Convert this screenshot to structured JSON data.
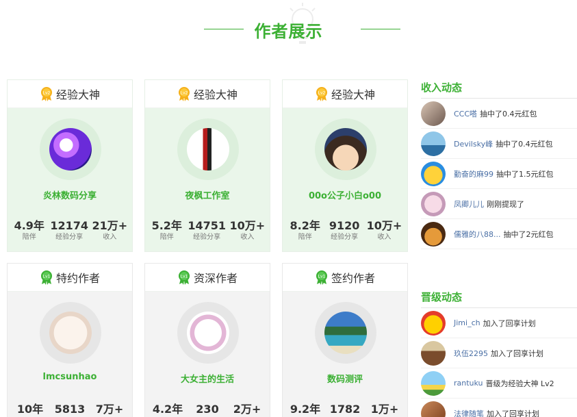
{
  "header": {
    "title": "作者展示"
  },
  "cards": [
    {
      "level_badge": "Lv2",
      "level": "经验大神",
      "name": "炎林数码分享",
      "stats": [
        {
          "value": "4.9年",
          "label": "陪伴"
        },
        {
          "value": "12174",
          "label": "经验分享"
        },
        {
          "value": "21万+",
          "label": "收入"
        }
      ]
    },
    {
      "level_badge": "Lv2",
      "level": "经验大神",
      "name": "夜枫工作室",
      "stats": [
        {
          "value": "5.2年",
          "label": "陪伴"
        },
        {
          "value": "14751",
          "label": "经验分享"
        },
        {
          "value": "10万+",
          "label": "收入"
        }
      ]
    },
    {
      "level_badge": "Lv2",
      "level": "经验大神",
      "name": "00o公子小白o00",
      "stats": [
        {
          "value": "8.2年",
          "label": "陪伴"
        },
        {
          "value": "9120",
          "label": "经验分享"
        },
        {
          "value": "10万+",
          "label": "收入"
        }
      ]
    },
    {
      "level_badge": "Lv1",
      "level": "特约作者",
      "name": "lmcsunhao",
      "stats": [
        {
          "value": "10年",
          "label": ""
        },
        {
          "value": "5813",
          "label": ""
        },
        {
          "value": "7万+",
          "label": ""
        }
      ]
    },
    {
      "level_badge": "Lv1",
      "level": "资深作者",
      "name": "大女主的生活",
      "stats": [
        {
          "value": "4.2年",
          "label": ""
        },
        {
          "value": "230",
          "label": ""
        },
        {
          "value": "2万+",
          "label": ""
        }
      ]
    },
    {
      "level_badge": "Lv1",
      "level": "签约作者",
      "name": "数码测评",
      "stats": [
        {
          "value": "9.2年",
          "label": ""
        },
        {
          "value": "1782",
          "label": ""
        },
        {
          "value": "1万+",
          "label": ""
        }
      ]
    }
  ],
  "income_feed": {
    "title": "收入动态",
    "items": [
      {
        "user": "CCC嗒",
        "action": "抽中了0.4元红包"
      },
      {
        "user": "Devilsky峰",
        "action": "抽中了0.4元红包"
      },
      {
        "user": "勤奋的麻99",
        "action": "抽中了1.5元红包"
      },
      {
        "user": "凤卿儿儿",
        "action": "刚刚提现了"
      },
      {
        "user": "儒雅的八88...",
        "action": "抽中了2元红包"
      }
    ]
  },
  "promo_feed": {
    "title": "晋级动态",
    "items": [
      {
        "user": "Jimi_ch",
        "action": "加入了回享计划"
      },
      {
        "user": "玖伍2295",
        "action": "加入了回享计划"
      },
      {
        "user": "rantuku",
        "action": "晋级为经验大神 Lv2"
      },
      {
        "user": "法律随笔",
        "action": "加入了回享计划"
      }
    ]
  },
  "colors": {
    "accent": "#3cb034",
    "card_bg": "#eaf6ea",
    "user_link": "#4a6fa5",
    "badge_gold": "#f5b01a",
    "badge_green": "#3cb034"
  }
}
